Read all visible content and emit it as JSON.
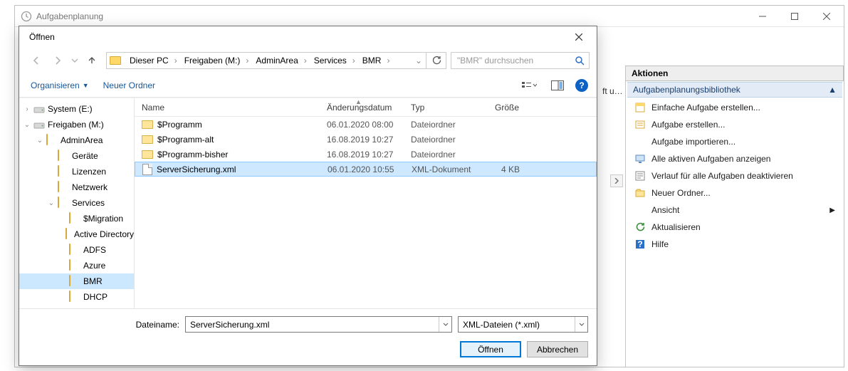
{
  "ts": {
    "title": "Aufgabenplanung",
    "actions_header": "Aktionen",
    "section": "Aufgabenplanungsbibliothek",
    "mid_text": "ft u…",
    "items": [
      {
        "icon": "wizard",
        "label": "Einfache Aufgabe erstellen..."
      },
      {
        "icon": "task",
        "label": "Aufgabe erstellen..."
      },
      {
        "icon": "none",
        "label": "Aufgabe importieren..."
      },
      {
        "icon": "display",
        "label": "Alle aktiven Aufgaben anzeigen"
      },
      {
        "icon": "history",
        "label": "Verlauf für alle Aufgaben deaktivieren"
      },
      {
        "icon": "newfolder",
        "label": "Neuer Ordner..."
      },
      {
        "icon": "none",
        "label": "Ansicht",
        "sub": true
      },
      {
        "icon": "refresh",
        "label": "Aktualisieren"
      },
      {
        "icon": "help",
        "label": "Hilfe"
      }
    ]
  },
  "dlg": {
    "title": "Öffnen",
    "toolbar": {
      "organize": "Organisieren",
      "newfolder": "Neuer Ordner"
    },
    "breadcrumb": [
      "Dieser PC",
      "Freigaben (M:)",
      "AdminArea",
      "Services",
      "BMR"
    ],
    "search_placeholder": "\"BMR\" durchsuchen",
    "columns": {
      "name": "Name",
      "modified": "Änderungsdatum",
      "type": "Typ",
      "size": "Größe"
    },
    "tree": [
      {
        "label": "System (E:)",
        "icon": "drive-sys",
        "indent": 0,
        "expand": ">"
      },
      {
        "label": "Freigaben (M:)",
        "icon": "drive-net",
        "indent": 0,
        "expand": "v"
      },
      {
        "label": "AdminArea",
        "icon": "folder-shield",
        "indent": 1,
        "expand": "v"
      },
      {
        "label": "Geräte",
        "icon": "folder",
        "indent": 2,
        "expand": ""
      },
      {
        "label": "Lizenzen",
        "icon": "folder",
        "indent": 2,
        "expand": ""
      },
      {
        "label": "Netzwerk",
        "icon": "folder",
        "indent": 2,
        "expand": ""
      },
      {
        "label": "Services",
        "icon": "folder",
        "indent": 2,
        "expand": "v"
      },
      {
        "label": "$Migration",
        "icon": "folder",
        "indent": 3,
        "expand": ""
      },
      {
        "label": "Active Directory",
        "icon": "folder",
        "indent": 3,
        "expand": ""
      },
      {
        "label": "ADFS",
        "icon": "folder",
        "indent": 3,
        "expand": ""
      },
      {
        "label": "Azure",
        "icon": "folder",
        "indent": 3,
        "expand": ""
      },
      {
        "label": "BMR",
        "icon": "folder",
        "indent": 3,
        "expand": "",
        "selected": true
      },
      {
        "label": "DHCP",
        "icon": "folder",
        "indent": 3,
        "expand": ""
      }
    ],
    "rows": [
      {
        "name": "$Programm",
        "mod": "06.01.2020 08:00",
        "type": "Dateiordner",
        "size": "",
        "icon": "folder"
      },
      {
        "name": "$Programm-alt",
        "mod": "16.08.2019 10:27",
        "type": "Dateiordner",
        "size": "",
        "icon": "folder"
      },
      {
        "name": "$Programm-bisher",
        "mod": "16.08.2019 10:27",
        "type": "Dateiordner",
        "size": "",
        "icon": "folder"
      },
      {
        "name": "ServerSicherung.xml",
        "mod": "06.01.2020 10:55",
        "type": "XML-Dokument",
        "size": "4 KB",
        "icon": "xml",
        "selected": true
      }
    ],
    "footer": {
      "filename_label": "Dateiname:",
      "filename_value": "ServerSicherung.xml",
      "filter": "XML-Dateien (*.xml)",
      "open": "Öffnen",
      "cancel": "Abbrechen"
    }
  }
}
